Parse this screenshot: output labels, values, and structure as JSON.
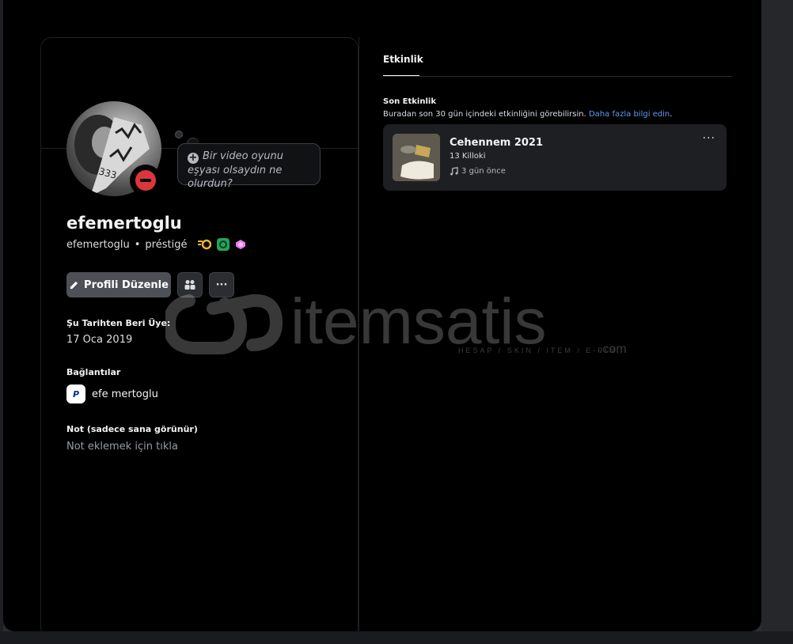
{
  "profile": {
    "display_name": "efemertoglu",
    "username": "efemertoglu",
    "separator": "•",
    "pronoun_tag": "préstigé",
    "status": "dnd"
  },
  "custom_status_bubble": {
    "placeholder": "Bir video oyunu eşyası olsaydın ne olurdun?"
  },
  "actions": {
    "edit_label": "Profili Düzenle",
    "more_label": "···"
  },
  "member_since": {
    "label": "Şu Tarihten Beri Üye:",
    "value": "17 Oca 2019"
  },
  "connections": {
    "label": "Bağlantılar",
    "items": [
      {
        "service": "paypal",
        "name": "efe mertoglu"
      }
    ]
  },
  "note": {
    "label": "Not (sadece sana görünür)",
    "placeholder": "Not eklemek için tıkla"
  },
  "activity_panel": {
    "tab_label": "Etkinlik",
    "recent_title": "Son Etkinlik",
    "recent_desc": "Buradan son 30 gün içindeki etkinliğini görebilirsin.",
    "learn_more": "Daha fazla bilgi edin",
    "items": [
      {
        "title": "Cehennem 2021",
        "artist": "13 Killoki",
        "time": "3 gün önce"
      }
    ]
  },
  "watermark": {
    "brand": "itemsatis",
    "tagline": "HESAP / SKIN / ITEM / E-PIN",
    "domain": ".com"
  }
}
